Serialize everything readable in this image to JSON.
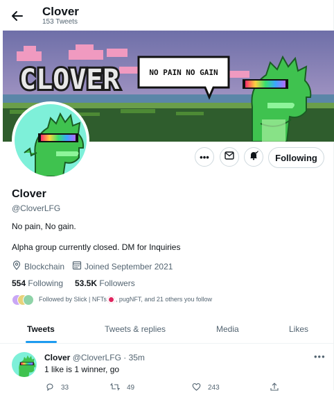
{
  "header": {
    "title": "Clover",
    "tweet_count": "153 Tweets"
  },
  "banner": {
    "logo_text": "CLOVER",
    "speech_text": "NO PAIN NO GAIN"
  },
  "profile": {
    "name": "Clover",
    "handle": "@CloverLFG",
    "bio_line1": "No pain, No gain.",
    "bio_line2": "Alpha group currently closed. DM for Inquiries",
    "location": "Blockchain",
    "joined": "Joined September 2021",
    "following_count": "554",
    "following_label": "Following",
    "followers_count": "53.5K",
    "followers_label": "Followers",
    "followed_by": "Followed by Slick | NFTs",
    "followed_by_rest": ", pugNFT, and 21 others you follow",
    "follow_button": "Following"
  },
  "tabs": [
    "Tweets",
    "Tweets & replies",
    "Media",
    "Likes"
  ],
  "tweet": {
    "name": "Clover",
    "handle_time": "@CloverLFG · 35m",
    "text": "1 like is 1 winner, go",
    "replies": "33",
    "retweets": "49",
    "likes": "243"
  },
  "colors": {
    "accent": "#1d9bf0",
    "secondary_text": "#536471",
    "dino_green": "#3fc24f",
    "banner_sky": "#7d7bb0"
  },
  "icons": [
    "back-arrow-icon",
    "more-icon",
    "mail-icon",
    "notification-bell-icon",
    "location-icon",
    "calendar-icon",
    "reply-icon",
    "retweet-icon",
    "like-icon",
    "share-icon"
  ]
}
